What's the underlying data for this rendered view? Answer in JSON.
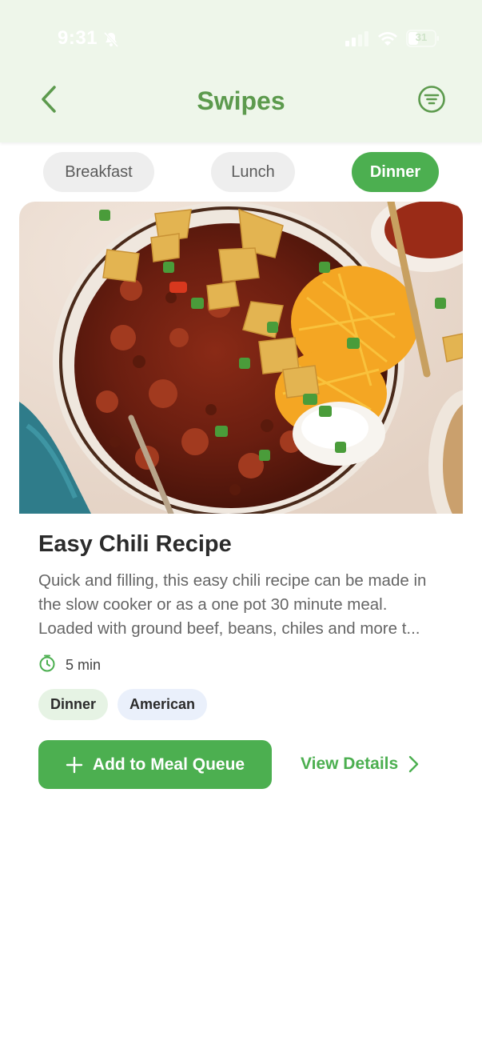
{
  "status_bar": {
    "time": "9:31",
    "battery": "31",
    "icons": [
      "bell-slash-icon",
      "signal-icon",
      "wifi-icon",
      "battery-icon"
    ]
  },
  "nav": {
    "title": "Swipes",
    "back_icon": "chevron-left-icon",
    "filter_icon": "filter-icon"
  },
  "tabs": [
    {
      "label": "Breakfast",
      "active": false
    },
    {
      "label": "Lunch",
      "active": false
    },
    {
      "label": "Dinner",
      "active": true
    }
  ],
  "recipe": {
    "image": "chili-bowl-photo",
    "title": "Easy Chili Recipe",
    "description": "Quick and filling, this easy chili recipe can be made in the slow cooker or as a one pot 30 minute meal. Loaded with ground beef, beans, chiles and more t...",
    "time": "5 min",
    "tags": [
      "Dinner",
      "American"
    ]
  },
  "actions": {
    "add_label": "Add to Meal Queue",
    "details_label": "View Details"
  },
  "colors": {
    "accent": "#4caf50",
    "title_green": "#5c9a4d",
    "header_bg": "#eef6ea"
  }
}
